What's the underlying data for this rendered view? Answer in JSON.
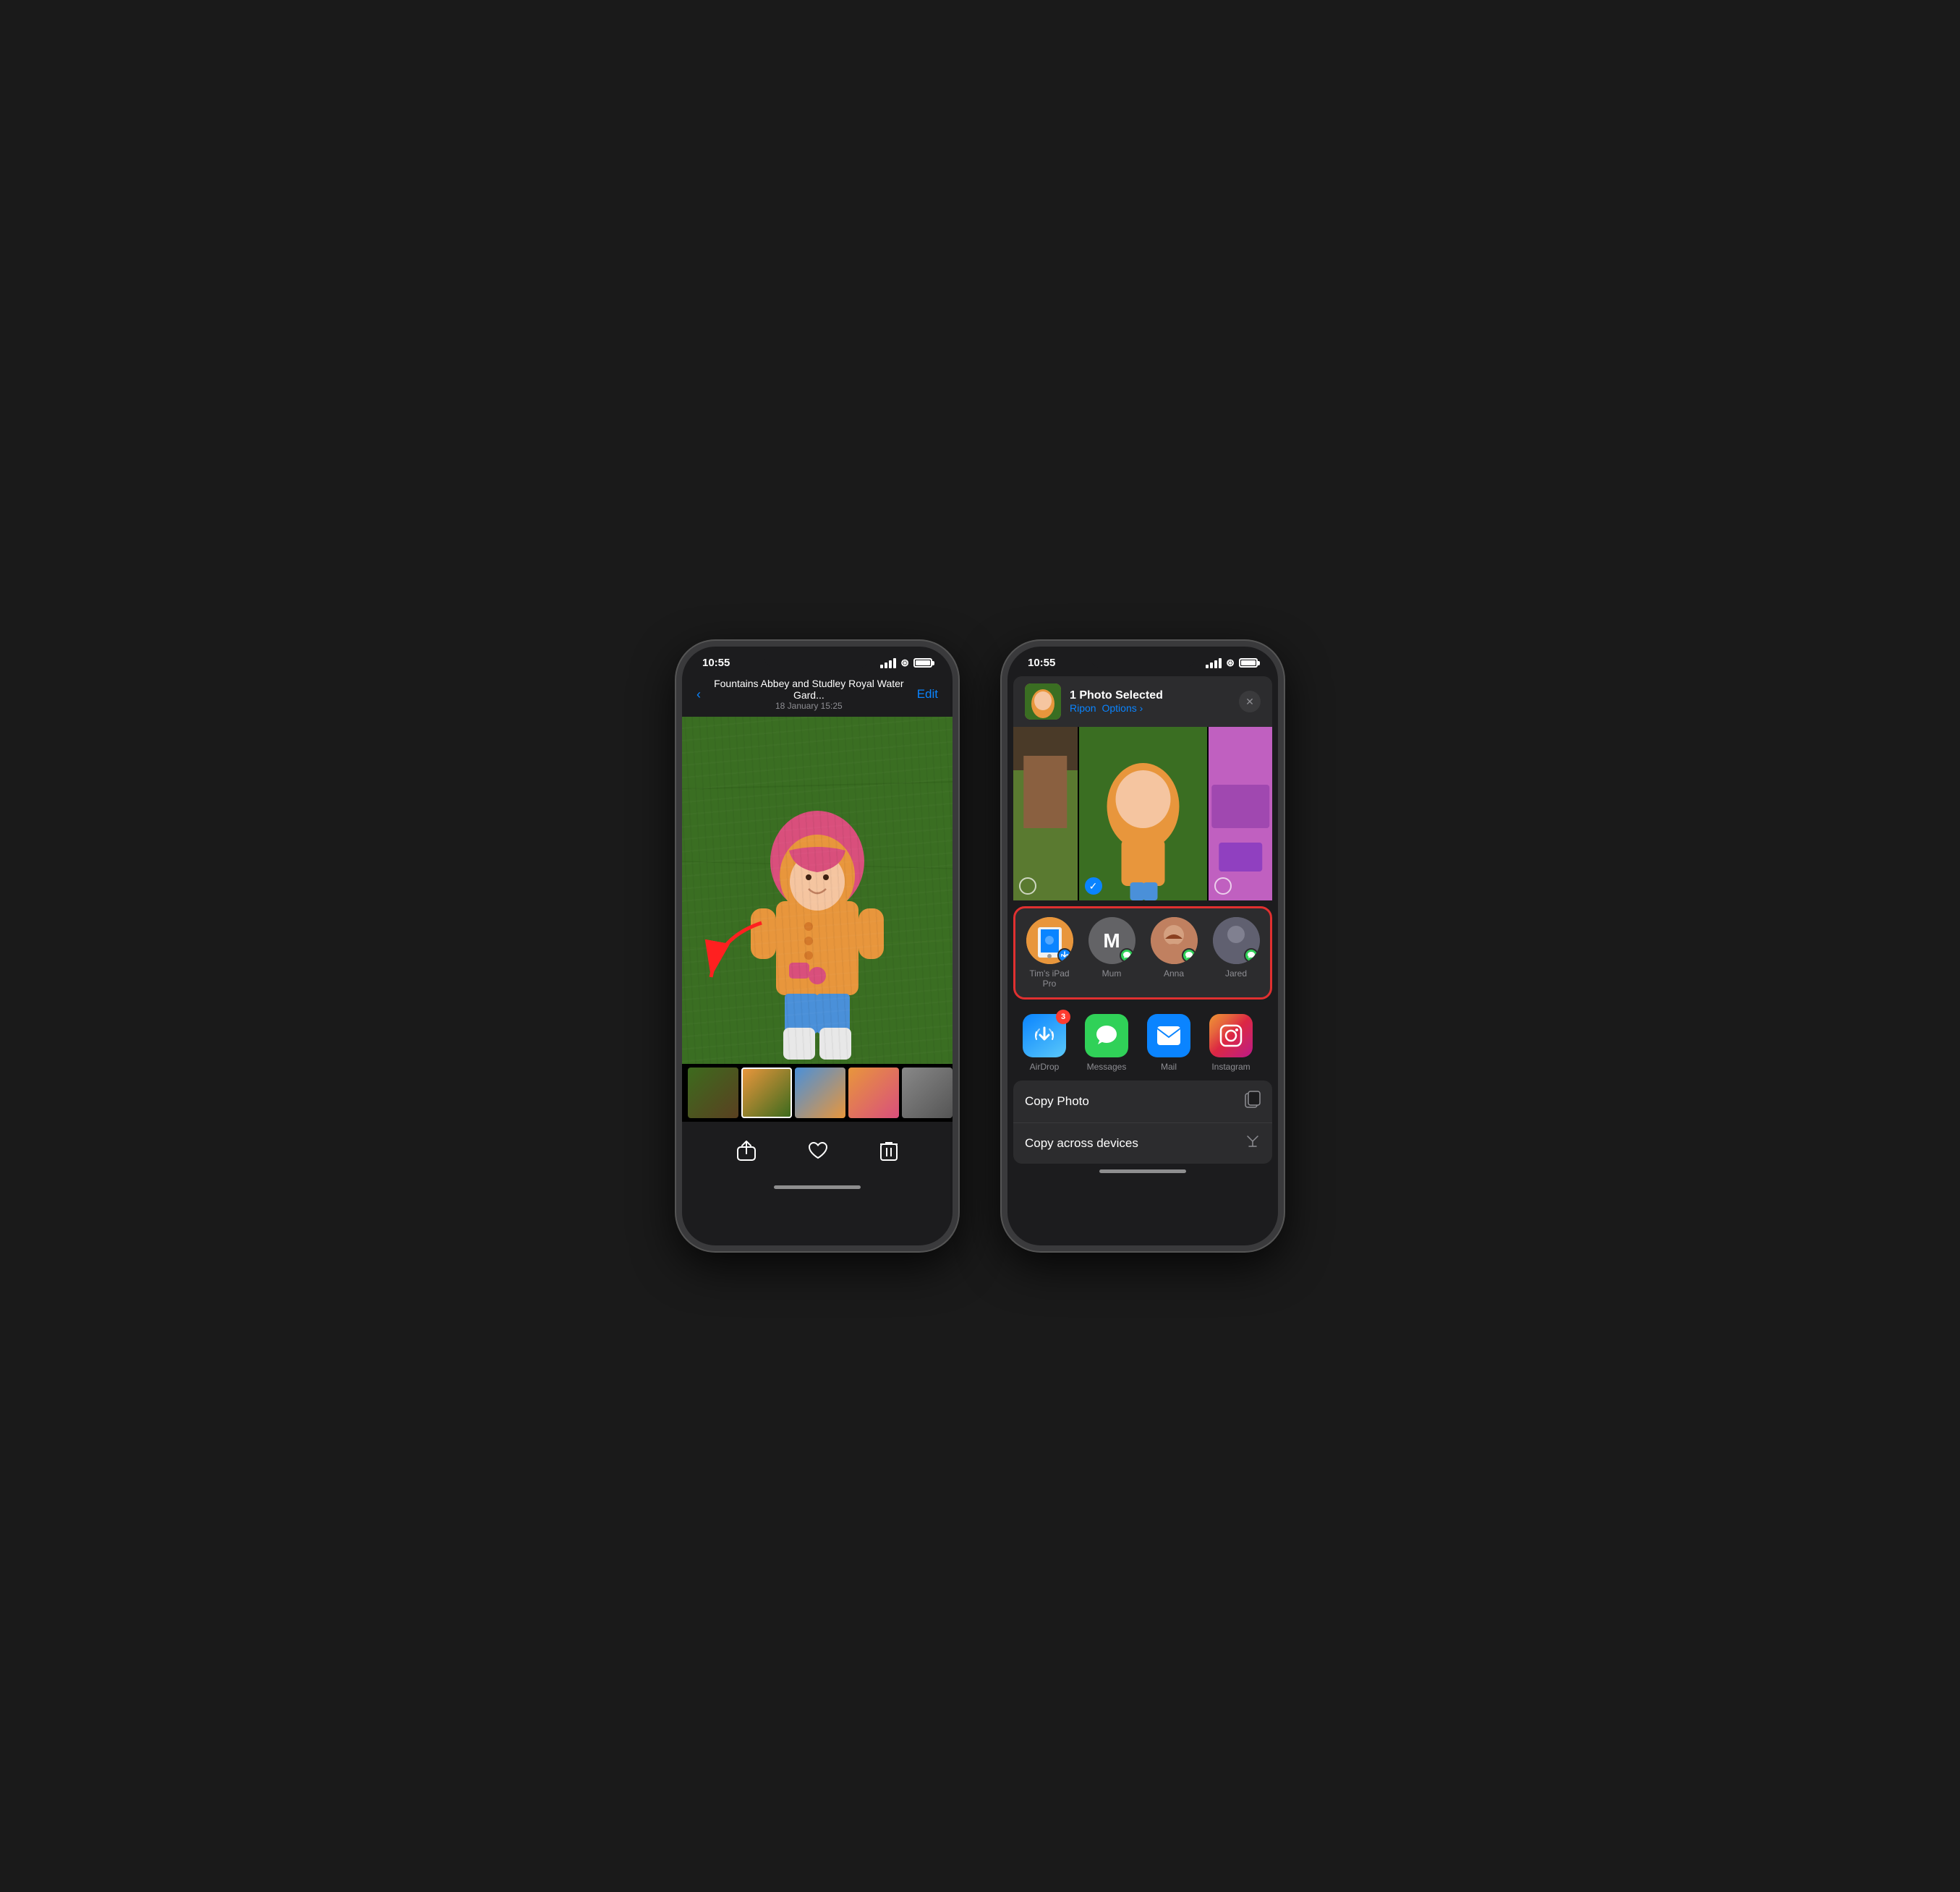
{
  "left_phone": {
    "status": {
      "time": "10:55",
      "signal": "●●●",
      "wifi": "wifi",
      "battery": "full"
    },
    "nav": {
      "back_label": "‹",
      "title": "Fountains Abbey and Studley Royal Water Gard...",
      "date": "18 January  15:25",
      "edit_label": "Edit"
    },
    "toolbar": {
      "share_label": "⬆",
      "like_label": "♡",
      "delete_label": "🗑"
    }
  },
  "right_phone": {
    "status": {
      "time": "10:55"
    },
    "share_header": {
      "title": "1 Photo Selected",
      "subtitle": "Ripon",
      "options_label": "Options ›",
      "close_label": "✕"
    },
    "people": [
      {
        "id": "tims-ipad",
        "name": "Tim's iPad Pro",
        "avatar_type": "ipad"
      },
      {
        "id": "mum",
        "name": "Mum",
        "avatar_type": "m"
      },
      {
        "id": "anna",
        "name": "Anna",
        "avatar_type": "anna"
      },
      {
        "id": "jared",
        "name": "Jared",
        "avatar_type": "jared"
      }
    ],
    "apps": [
      {
        "id": "airdrop",
        "name": "AirDrop",
        "badge": "3",
        "type": "airdrop"
      },
      {
        "id": "messages",
        "name": "Messages",
        "badge": null,
        "type": "messages"
      },
      {
        "id": "mail",
        "name": "Mail",
        "badge": null,
        "type": "mail"
      },
      {
        "id": "instagram",
        "name": "Instagram",
        "badge": null,
        "type": "instagram"
      }
    ],
    "actions": [
      {
        "id": "copy-photo",
        "label": "Copy Photo",
        "icon": "⧉"
      },
      {
        "id": "copy-across",
        "label": "Copy across devices",
        "icon": "✂"
      }
    ]
  }
}
